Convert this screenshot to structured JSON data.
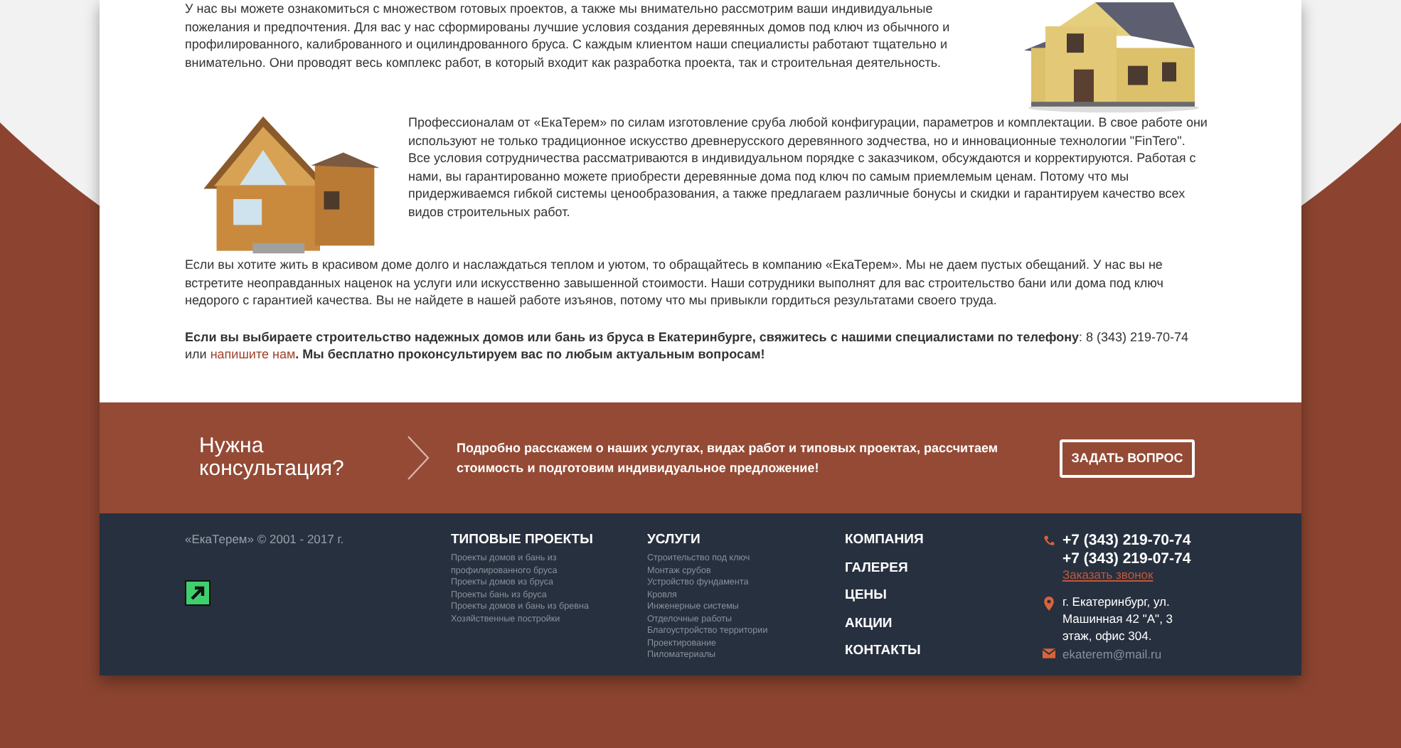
{
  "article": {
    "paragraphs": [
      "У нас вы можете ознакомиться с множеством готовых проектов, а также мы внимательно рассмотрим ваши индивидуальные пожелания и предпочтения. Для вас у нас сформированы лучшие условия создания деревянных домов под ключ из обычного и профилированного, калиброванного и оцилиндрованного бруса. С каждым клиентом наши специалисты работают тщательно и внимательно. Они проводят весь комплекс работ, в который входит как разработка проекта, так и строительная деятельность.",
      "Профессионалам от «ЕкаТерем» по силам изготовление сруба любой конфигурации, параметров и комплектации. В свое работе они используют не только традиционное искусство древнерусского деревянного зодчества, но и инновационные технологии \"FinTero\". Все условия сотрудничества рассматриваются в индивидуальном порядке с заказчиком, обсуждаются и корректируются. Работая с нами, вы гарантированно можете приобрести деревянные дома под ключ по самым приемлемым ценам. Потому что мы придерживаемся гибкой системы ценообразования, а также предлагаем различные бонусы и скидки и гарантируем качество всех видов строительных работ.",
      "Если вы хотите жить в красивом доме долго и наслаждаться теплом и уютом, то обращайтесь в компанию «ЕкаТерем». Мы не даем пустых обещаний. У нас вы не встретите неоправданных наценок на услуги или искусственно завышенной стоимости. Наши сотрудники выполнят для вас строительство бани или дома под ключ недорого с гарантией качества. Вы не найдете в нашей работе изъянов, потому что мы привыкли гордиться результатами своего труда."
    ],
    "call_to_action": {
      "before": "**Если вы выбираете строительство надежных домов или бань из бруса в Екатеринбурге, свяжитесь с нашими специалистами по телефону**: 8 (343) 219-70-74 или",
      "link": "напишите нам",
      "after": "**. Мы бесплатно проконсультируем вас по любым актуальным вопросам!**"
    }
  },
  "consultation": {
    "title": "Нужна консультация?",
    "text": "Подробно расскажем о наших услугах, видах работ и типовых проектах, рассчитаем стоимость и подготовим индивидуальное предложение!",
    "button": "ЗАДАТЬ ВОПРОС"
  },
  "footer": {
    "copyright": "«ЕкаТерем» © 2001 - 2017 г.",
    "columns": [
      {
        "title": "ТИПОВЫЕ ПРОЕКТЫ",
        "links": [
          "Проекты домов и бань из профилированного бруса",
          "Проекты домов из бруса",
          "Проекты бань из бруса",
          "Проекты домов и бань из бревна",
          "Хозяйственные постройки"
        ]
      },
      {
        "title": "УСЛУГИ",
        "links": [
          "Строительство под ключ",
          "Монтаж срубов",
          "Устройство фундамента",
          "Кровля",
          "Инженерные системы",
          "Отделочные работы",
          "Благоустройство территории",
          "Проектирование",
          "Пиломатериалы"
        ]
      }
    ],
    "menu": [
      "КОМПАНИЯ",
      "ГАЛЕРЕЯ",
      "ЦЕНЫ",
      "АКЦИИ",
      "КОНТАКТЫ"
    ],
    "contacts": {
      "phones": [
        "+7 (343) 219-70-74",
        "+7 (343) 219-07-74"
      ],
      "callback": "Заказать звонок",
      "address": "г. Екатеринбург, ул. Машинная 42 \"А\", 3 этаж, офис 304.",
      "email": "ekaterem@mail.ru"
    }
  }
}
